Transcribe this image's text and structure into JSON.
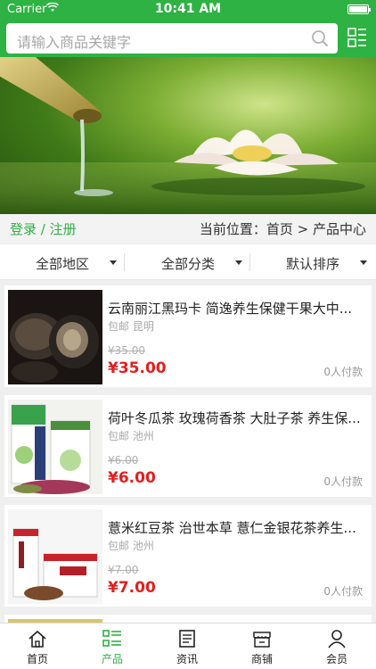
{
  "status_bar": {
    "carrier": "Carrier",
    "time": "10:41 AM"
  },
  "search": {
    "placeholder": "请输入商品关键字",
    "icon": "search-icon"
  },
  "menu_icon": "grid-menu-icon",
  "breadcrumb": {
    "login": "登录 / 注册",
    "location": "当前位置：首页 > 产品中心"
  },
  "filters": [
    {
      "label": "全部地区"
    },
    {
      "label": "全部分类"
    },
    {
      "label": "默认排序"
    }
  ],
  "products": [
    {
      "title": "云南丽江黑玛卡 简逸养生保健干果大中...",
      "shipping": "包邮  昆明",
      "old_price": "¥35.00",
      "price": "¥35.00",
      "paid": "0人付款"
    },
    {
      "title": "荷叶冬瓜茶 玫瑰荷香茶 大肚子茶 养生保...",
      "shipping": "包邮  池州",
      "old_price": "¥6.00",
      "price": "¥6.00",
      "paid": "0人付款"
    },
    {
      "title": "薏米红豆茶 治世本草 薏仁金银花茶养生...",
      "shipping": "包邮  池州",
      "old_price": "¥7.00",
      "price": "¥7.00",
      "paid": "0人付款"
    }
  ],
  "tabs": [
    {
      "label": "首页",
      "icon": "home-icon"
    },
    {
      "label": "产品",
      "icon": "product-list-icon"
    },
    {
      "label": "资讯",
      "icon": "news-icon"
    },
    {
      "label": "商铺",
      "icon": "shop-icon"
    },
    {
      "label": "会员",
      "icon": "member-icon"
    }
  ],
  "colors": {
    "brand": "#2eb243",
    "price": "#e41e1e"
  }
}
